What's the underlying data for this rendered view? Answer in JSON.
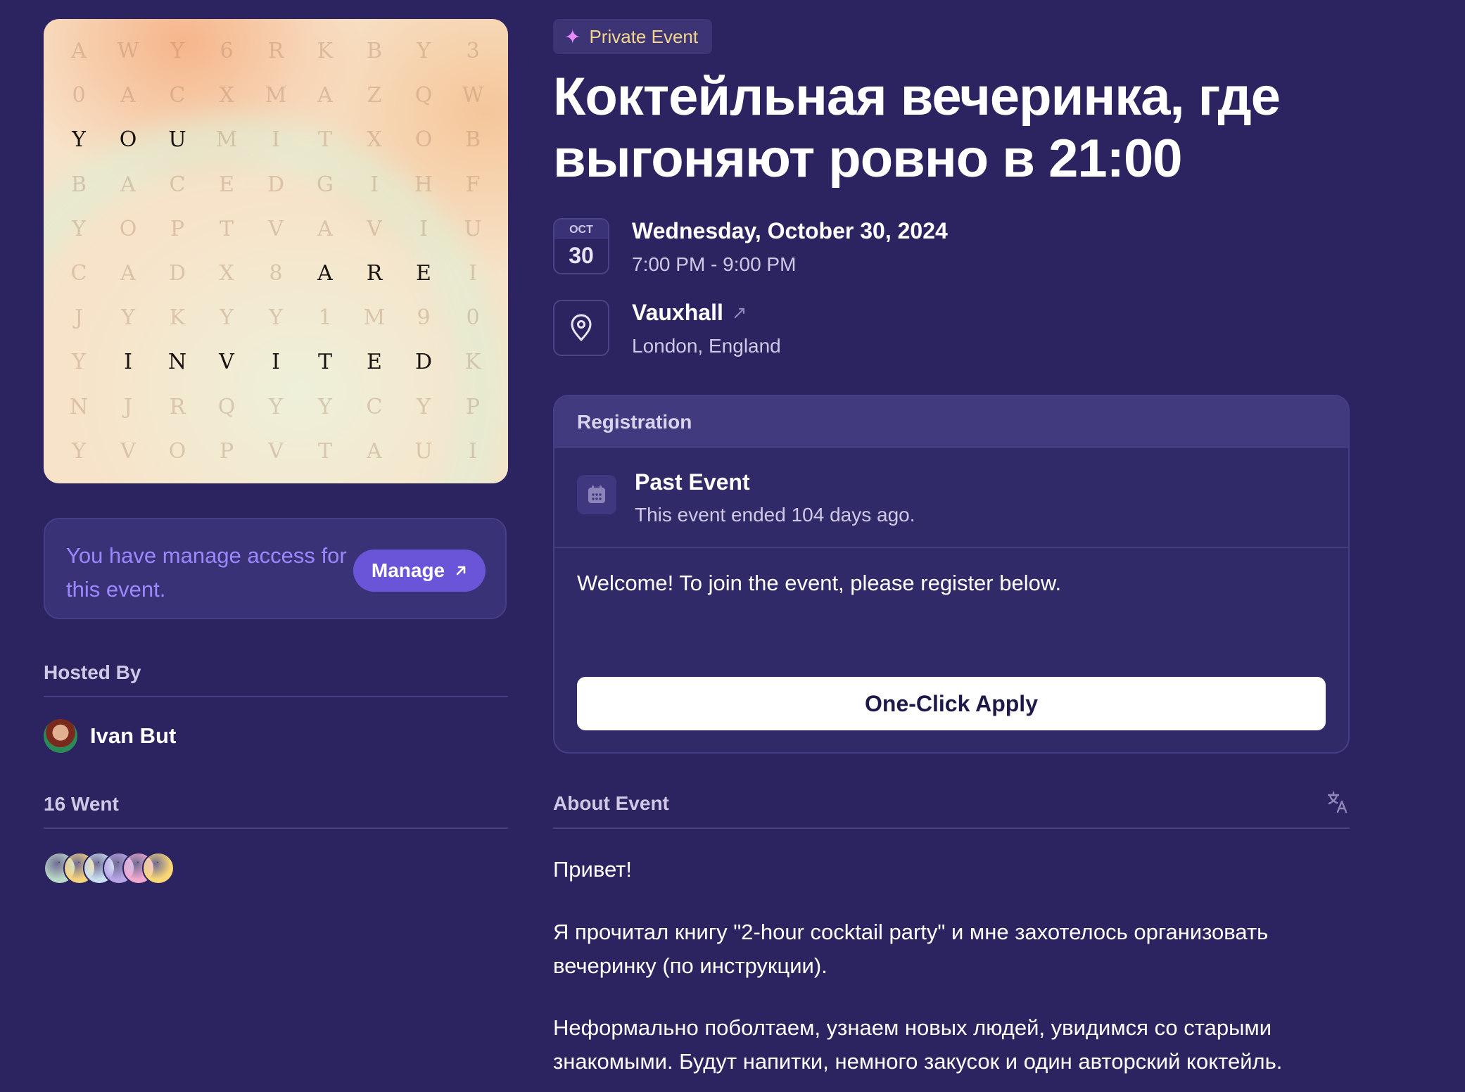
{
  "cover": {
    "rows": [
      [
        "A",
        "W",
        "Y",
        "6",
        "R",
        "K",
        "B",
        "Y",
        "3"
      ],
      [
        "0",
        "A",
        "C",
        "X",
        "M",
        "A",
        "Z",
        "Q",
        "W"
      ],
      [
        "Y",
        "O",
        "U",
        "M",
        "I",
        "T",
        "X",
        "O",
        "B"
      ],
      [
        "B",
        "A",
        "C",
        "E",
        "D",
        "G",
        "I",
        "H",
        "F"
      ],
      [
        "Y",
        "O",
        "P",
        "T",
        "V",
        "A",
        "V",
        "I",
        "U"
      ],
      [
        "C",
        "A",
        "D",
        "X",
        "8",
        "A",
        "R",
        "E",
        "I"
      ],
      [
        "J",
        "Y",
        "K",
        "Y",
        "Y",
        "1",
        "M",
        "9",
        "0"
      ],
      [
        "Y",
        "I",
        "N",
        "V",
        "I",
        "T",
        "E",
        "D",
        "K"
      ],
      [
        "N",
        "J",
        "R",
        "Q",
        "Y",
        "Y",
        "C",
        "Y",
        "P"
      ],
      [
        "Y",
        "V",
        "O",
        "P",
        "V",
        "T",
        "A",
        "U",
        "I"
      ]
    ],
    "highlight": [
      [
        2,
        0
      ],
      [
        2,
        1
      ],
      [
        2,
        2
      ],
      [
        5,
        5
      ],
      [
        5,
        6
      ],
      [
        5,
        7
      ],
      [
        7,
        1
      ],
      [
        7,
        2
      ],
      [
        7,
        3
      ],
      [
        7,
        4
      ],
      [
        7,
        5
      ],
      [
        7,
        6
      ],
      [
        7,
        7
      ]
    ]
  },
  "manage": {
    "text": "You have manage access for this event.",
    "button_label": "Manage"
  },
  "hosted_by": {
    "label": "Hosted By",
    "host_name": "Ivan But"
  },
  "attendees": {
    "label": "16 Went",
    "avatar_colors": [
      "#b9d8c6",
      "#f5d37a",
      "#c9dff0",
      "#b7a5e6",
      "#f0a8cf",
      "#f8d774"
    ]
  },
  "event": {
    "badge": "Private Event",
    "title": "Коктейльная вечеринка, где выгоняют ровно в 21:00",
    "date_month": "OCT",
    "date_day": "30",
    "date_full": "Wednesday, October 30, 2024",
    "time_range": "7:00 PM - 9:00 PM",
    "venue": "Vauxhall",
    "city": "London, England"
  },
  "registration": {
    "header": "Registration",
    "status_title": "Past Event",
    "status_sub": "This event ended 104 days ago.",
    "welcome": "Welcome! To join the event, please register below.",
    "apply_label": "One-Click Apply"
  },
  "about": {
    "label": "About Event",
    "paragraphs": [
      "Привет!",
      "Я прочитал книгу \"2-hour cocktail party\" и мне захотелось организовать вечеринку (по инструкции).",
      "Неформально поболтаем, узнаем новых людей, увидимся со старыми знакомыми. Будут напитки, немного закусок и один авторский коктейль."
    ]
  },
  "colors": {
    "background": "#2c2460",
    "accent": "#6a55d9",
    "manage_text": "#9b88ff",
    "badge_text": "#f1d68a"
  }
}
